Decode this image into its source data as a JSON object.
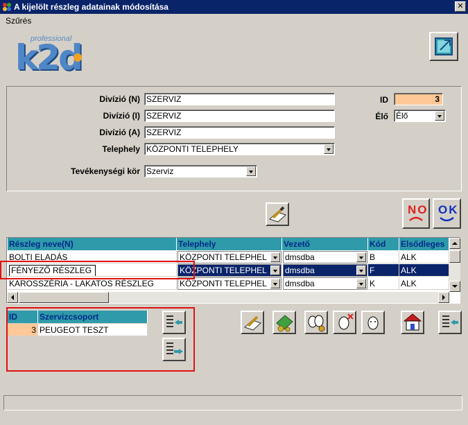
{
  "window": {
    "title": "A kijelölt részleg adatainak módosítása",
    "close_glyph": "✕"
  },
  "menu": {
    "filter": "Szűrés"
  },
  "logo": {
    "professional": "professional",
    "brand": "k2d"
  },
  "form": {
    "division_n_label": "Divízió (N)",
    "division_n_value": "SZERVIZ",
    "division_i_label": "Divízió (I)",
    "division_i_value": "SZERVIZ",
    "division_a_label": "Divízió (A)",
    "division_a_value": "SZERVIZ",
    "site_label": "Telephely",
    "site_value": "KÖZPONTI TELEPHELY",
    "activity_label": "Tevékenységi kör",
    "activity_value": "Szerviz",
    "id_label": "ID",
    "id_value": "3",
    "alive_label": "Élő",
    "alive_value": "Élő"
  },
  "buttons": {
    "no_label": "NO",
    "ok_label": "OK"
  },
  "grid": {
    "columns": [
      "Részleg neve(N)",
      "Telephely",
      "Vezető",
      "Kód",
      "Elsődleges"
    ],
    "rows": [
      [
        "BOLTI ELADÁS",
        "KÖZPONTI TELEPHEL",
        "dmsdba",
        "B",
        "ALK"
      ],
      [
        "FÉNYEZŐ RÉSZLEG",
        "KÖZPONTI TELEPHEL",
        "dmsdba",
        "F",
        "ALK"
      ],
      [
        "KAROSSZÉRIA - LAKATOS RÉSZLEG",
        "KÖZPONTI TELEPHEL",
        "dmsdba",
        "K",
        "ALK"
      ]
    ]
  },
  "subgrid": {
    "columns": [
      "ID",
      "Szervizcsoport"
    ],
    "rows": [
      [
        "3",
        "PEUGEOT TESZT"
      ]
    ]
  },
  "colors": {
    "title_bar": "#0a246a",
    "grid_header": "#2f9aa9",
    "id_field": "#ffc896",
    "highlight": "#e01010"
  }
}
